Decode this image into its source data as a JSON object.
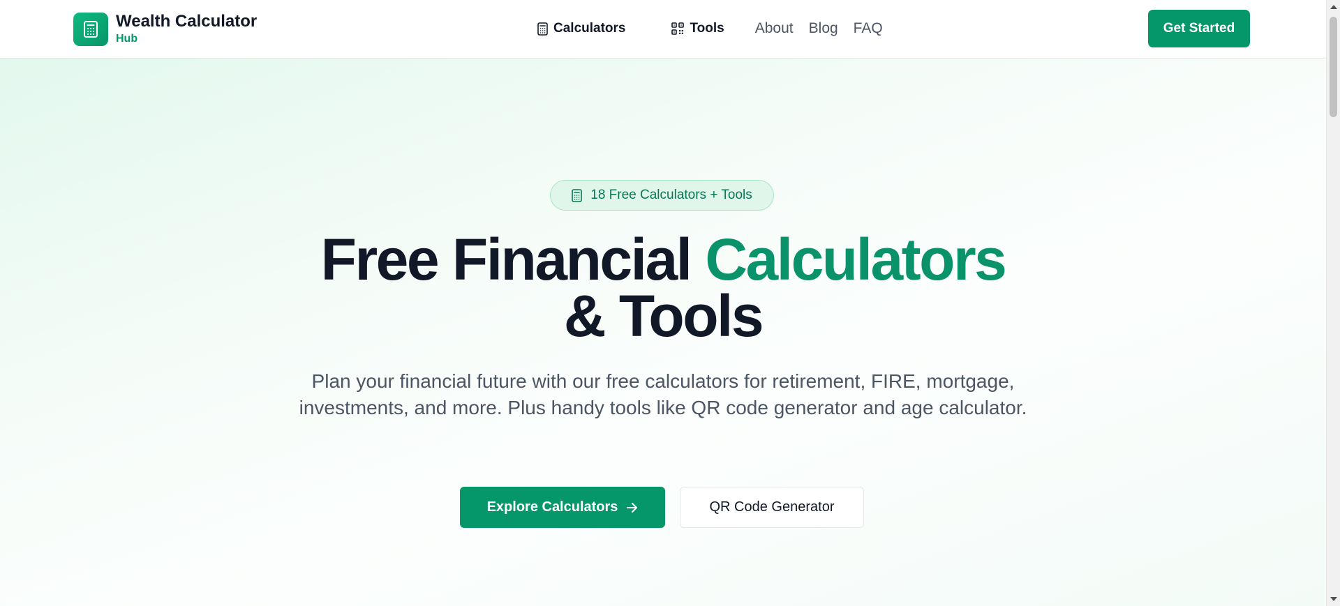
{
  "header": {
    "logo": {
      "title": "Wealth Calculator",
      "subtitle": "Hub",
      "icon": "calculator-icon"
    },
    "nav": {
      "calculators_label": "Calculators",
      "calculators_icon": "calculator-icon",
      "tools_label": "Tools",
      "tools_icon": "qr-code-icon",
      "links": [
        "About",
        "Blog",
        "FAQ"
      ]
    },
    "cta_label": "Get Started"
  },
  "hero": {
    "badge": {
      "icon": "calculator-icon",
      "text": "18 Free Calculators + Tools"
    },
    "headline_part1": "Free Financial",
    "headline_accent": "Calculators",
    "headline_part2": "& Tools",
    "description": "Plan your financial future with our free calculators for retirement, FIRE, mortgage, investments, and more. Plus handy tools like QR code generator and age calculator.",
    "primary_button": {
      "label": "Explore Calculators",
      "icon": "arrow-right-icon"
    },
    "secondary_button": {
      "label": "QR Code Generator"
    }
  },
  "colors": {
    "brand": "#059669",
    "accent_text": "#0a936b",
    "heading": "#111827",
    "body_text": "#4b5563"
  }
}
